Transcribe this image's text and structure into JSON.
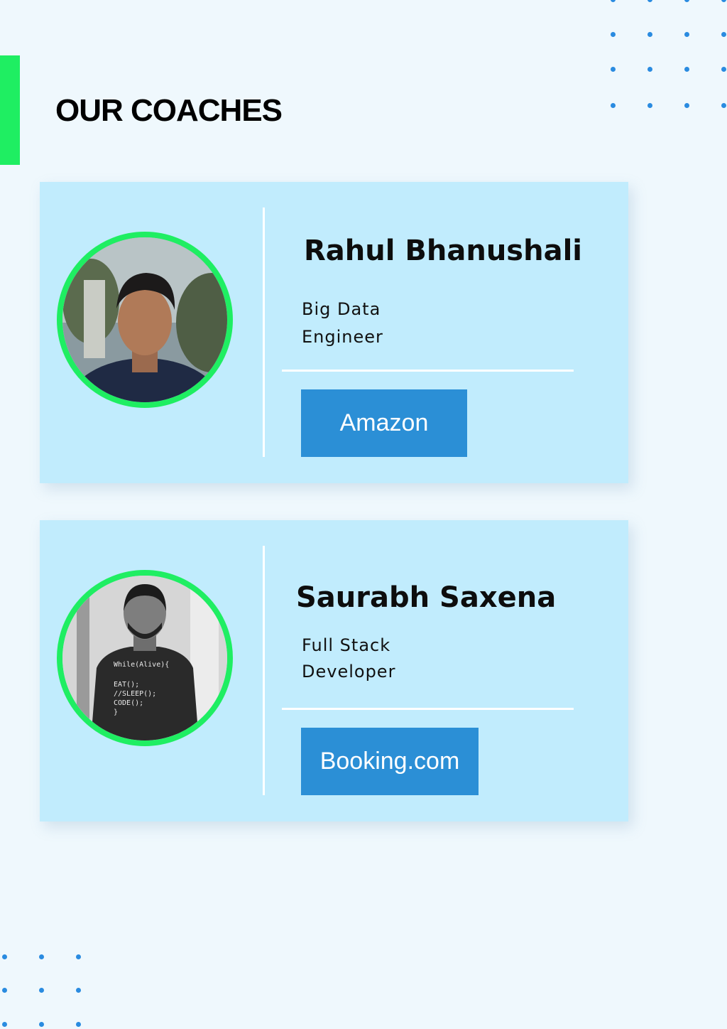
{
  "page": {
    "title": "OUR COACHES"
  },
  "colors": {
    "background": "#eff8fd",
    "accent_green": "#1fee62",
    "card_background": "#c1ecfd",
    "button_blue": "#2b8fd6",
    "dot_blue": "#2a8be0"
  },
  "coaches": [
    {
      "name": "Rahul Bhanushali",
      "role": "Big Data\nEngineer",
      "company": "Amazon",
      "photo": "coach-photo-color"
    },
    {
      "name": "Saurabh Saxena",
      "role": "Full Stack\nDeveloper",
      "company": "Booking.com",
      "photo": "coach-photo-grayscale",
      "tshirt_text": [
        "While(Alive){",
        "EAT();",
        "//SLEEP();",
        "CODE();",
        "}"
      ]
    }
  ]
}
